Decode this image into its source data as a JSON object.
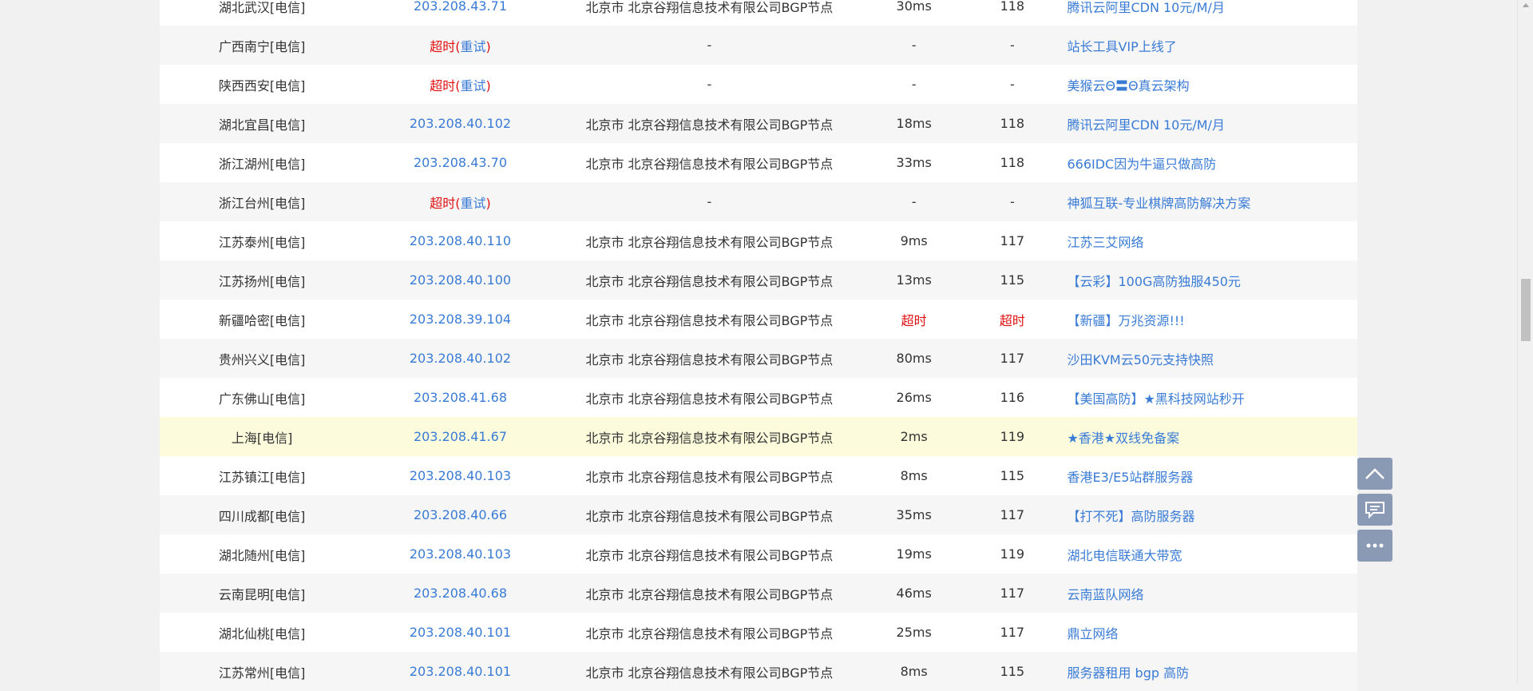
{
  "labels": {
    "timeout": "超时",
    "retry": "重试",
    "lparen": "(",
    "rparen": ")"
  },
  "rows": [
    {
      "location": "湖北武汉[电信]",
      "ip": "203.208.43.71",
      "isp": "北京市 北京谷翔信息技术有限公司BGP节点",
      "ms": "30ms",
      "ttl": "118",
      "ad": "腾讯云阿里CDN 10元/M/月"
    },
    {
      "location": "广西南宁[电信]",
      "ip": "",
      "timeout_retry": true,
      "isp": "-",
      "ms": "-",
      "ttl": "-",
      "ad": "站长工具VIP上线了"
    },
    {
      "location": "陕西西安[电信]",
      "ip": "",
      "timeout_retry": true,
      "isp": "-",
      "ms": "-",
      "ttl": "-",
      "ad": "美猴云Θ〓Θ真云架构"
    },
    {
      "location": "湖北宜昌[电信]",
      "ip": "203.208.40.102",
      "isp": "北京市 北京谷翔信息技术有限公司BGP节点",
      "ms": "18ms",
      "ttl": "118",
      "ad": "腾讯云阿里CDN 10元/M/月"
    },
    {
      "location": "浙江湖州[电信]",
      "ip": "203.208.43.70",
      "isp": "北京市 北京谷翔信息技术有限公司BGP节点",
      "ms": "33ms",
      "ttl": "118",
      "ad": "666IDC因为牛逼只做高防"
    },
    {
      "location": "浙江台州[电信]",
      "ip": "",
      "timeout_retry": true,
      "isp": "-",
      "ms": "-",
      "ttl": "-",
      "ad": "神狐互联-专业棋牌高防解决方案"
    },
    {
      "location": "江苏泰州[电信]",
      "ip": "203.208.40.110",
      "isp": "北京市 北京谷翔信息技术有限公司BGP节点",
      "ms": "9ms",
      "ttl": "117",
      "ad": "江苏三艾网络"
    },
    {
      "location": "江苏扬州[电信]",
      "ip": "203.208.40.100",
      "isp": "北京市 北京谷翔信息技术有限公司BGP节点",
      "ms": "13ms",
      "ttl": "115",
      "ad": "【云彩】100G高防独服450元"
    },
    {
      "location": "新疆哈密[电信]",
      "ip": "203.208.39.104",
      "isp": "北京市 北京谷翔信息技术有限公司BGP节点",
      "ms": "超时",
      "ttl": "超时",
      "ms_timeout": true,
      "ad": "【新疆】万兆资源!!!"
    },
    {
      "location": "贵州兴义[电信]",
      "ip": "203.208.40.102",
      "isp": "北京市 北京谷翔信息技术有限公司BGP节点",
      "ms": "80ms",
      "ttl": "117",
      "ad": "沙田KVM云50元支持快照"
    },
    {
      "location": "广东佛山[电信]",
      "ip": "203.208.41.68",
      "isp": "北京市 北京谷翔信息技术有限公司BGP节点",
      "ms": "26ms",
      "ttl": "116",
      "ad": "【美国高防】★黑科技网站秒开"
    },
    {
      "location": "上海[电信]",
      "ip": "203.208.41.67",
      "isp": "北京市 北京谷翔信息技术有限公司BGP节点",
      "ms": "2ms",
      "ttl": "119",
      "ad": "★香港★双线免备案",
      "highlight": true
    },
    {
      "location": "江苏镇江[电信]",
      "ip": "203.208.40.103",
      "isp": "北京市 北京谷翔信息技术有限公司BGP节点",
      "ms": "8ms",
      "ttl": "115",
      "ad": "香港E3/E5站群服务器"
    },
    {
      "location": "四川成都[电信]",
      "ip": "203.208.40.66",
      "isp": "北京市 北京谷翔信息技术有限公司BGP节点",
      "ms": "35ms",
      "ttl": "117",
      "ad": "【打不死】高防服务器"
    },
    {
      "location": "湖北随州[电信]",
      "ip": "203.208.40.103",
      "isp": "北京市 北京谷翔信息技术有限公司BGP节点",
      "ms": "19ms",
      "ttl": "119",
      "ad": "湖北电信联通大带宽"
    },
    {
      "location": "云南昆明[电信]",
      "ip": "203.208.40.68",
      "isp": "北京市 北京谷翔信息技术有限公司BGP节点",
      "ms": "46ms",
      "ttl": "117",
      "ad": "云南蓝队网络"
    },
    {
      "location": "湖北仙桃[电信]",
      "ip": "203.208.40.101",
      "isp": "北京市 北京谷翔信息技术有限公司BGP节点",
      "ms": "25ms",
      "ttl": "117",
      "ad": "鼎立网络"
    },
    {
      "location": "江苏常州[电信]",
      "ip": "203.208.40.101",
      "isp": "北京市 北京谷翔信息技术有限公司BGP节点",
      "ms": "8ms",
      "ttl": "115",
      "ad": "服务器租用 bgp 高防"
    }
  ],
  "floating_buttons": [
    {
      "icon": "chevron-up-icon"
    },
    {
      "icon": "chat-icon"
    },
    {
      "icon": "more-icon"
    }
  ],
  "colors": {
    "link": "#3a7bd5",
    "timeout": "#e01010",
    "highlight_row": "#fcfcdd",
    "float_button": "#8a9ab5"
  }
}
